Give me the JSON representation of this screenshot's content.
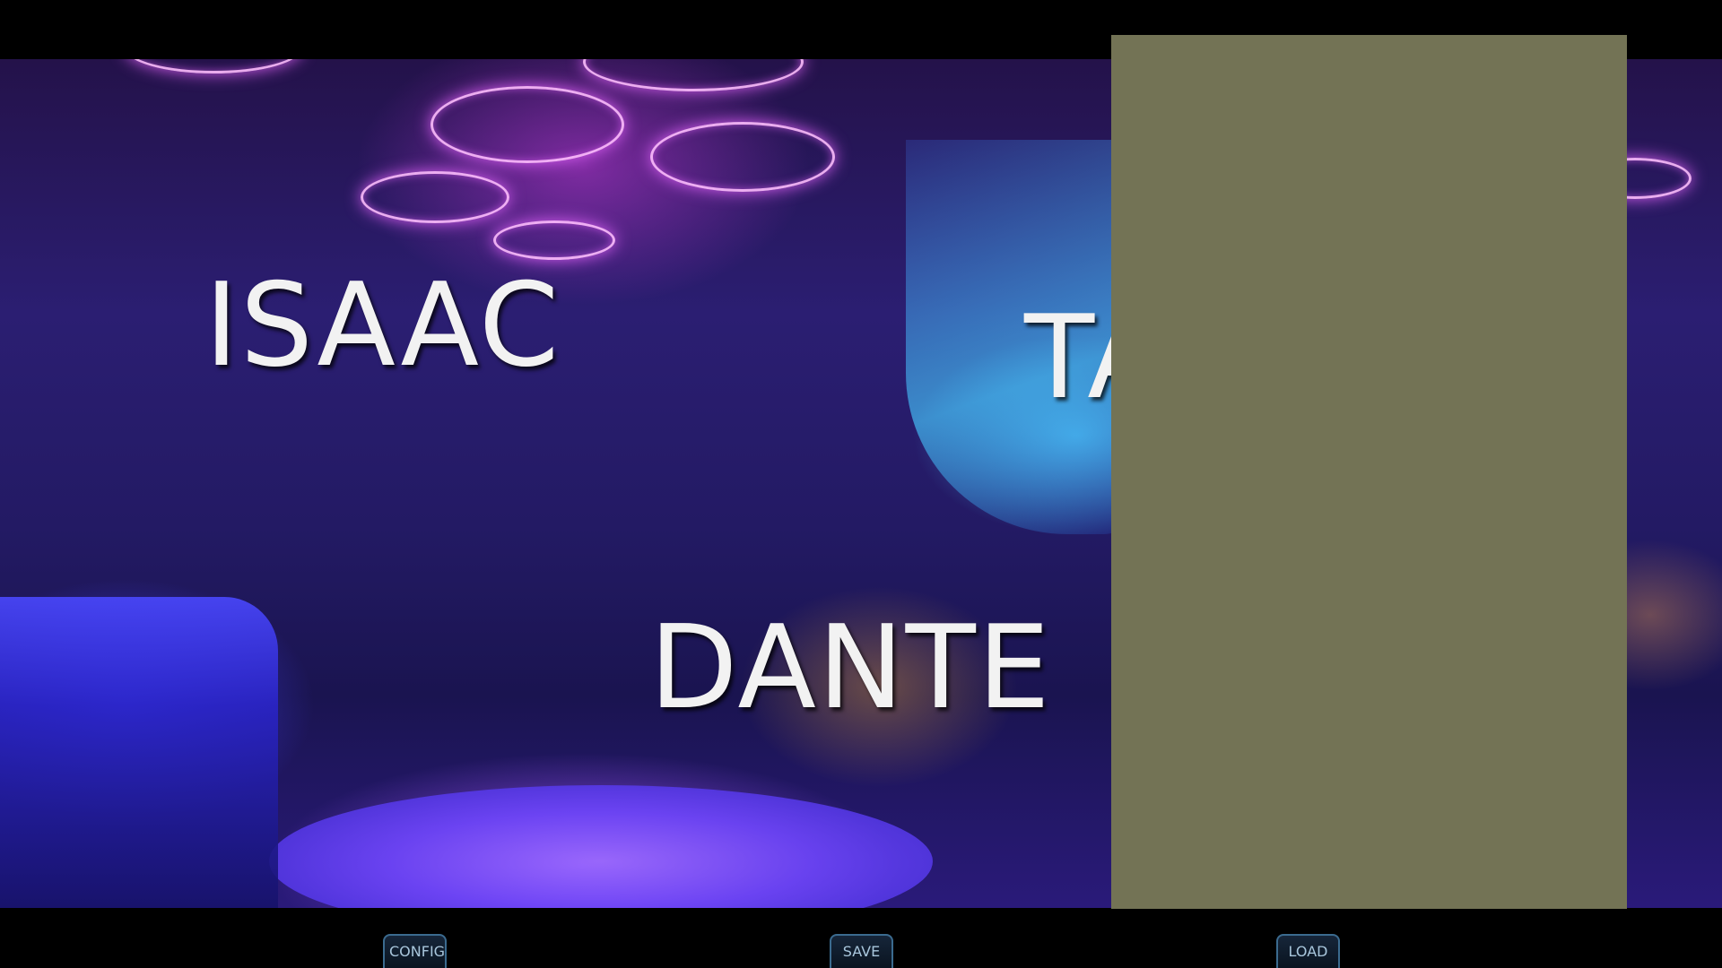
{
  "scene": {
    "background": "nightclub-lounge",
    "accent_colors": {
      "neon_purple": "#d76bff",
      "neon_blue": "#4a48ff",
      "cyan_light": "#50c8ff",
      "warm_light": "#ffb43c"
    }
  },
  "character_choices": [
    {
      "label": "ISAAC"
    },
    {
      "label": "TA"
    },
    {
      "label": "DANTE"
    }
  ],
  "overlay_panel": {
    "color": "#737355"
  },
  "quick_menu": {
    "config_label": "CONFIG",
    "save_label": "SAVE",
    "load_label": "LOAD"
  }
}
